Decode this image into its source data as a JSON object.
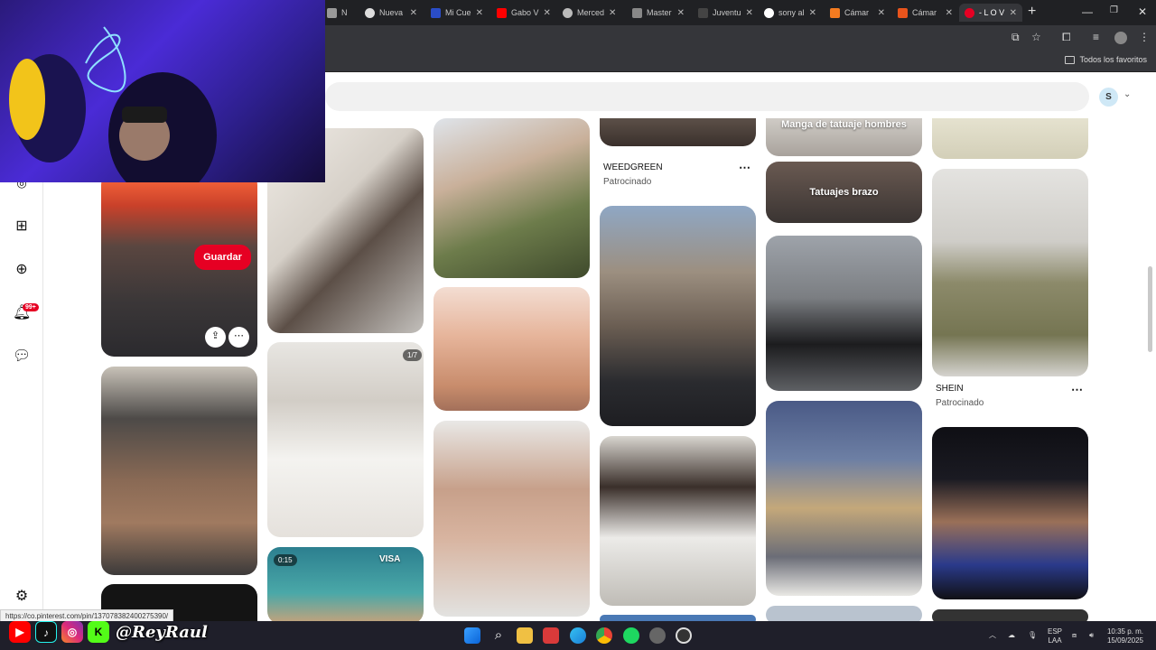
{
  "browser": {
    "tabs": [
      {
        "label": "N"
      },
      {
        "label": "Nueva"
      },
      {
        "label": "Mi Cue"
      },
      {
        "label": "Gabo V"
      },
      {
        "label": "Merced"
      },
      {
        "label": "Master"
      },
      {
        "label": "Juventu"
      },
      {
        "label": "sony al"
      },
      {
        "label": "Cámar"
      },
      {
        "label": "Cámar"
      },
      {
        "label": "- L O V"
      }
    ],
    "new_tab": "+",
    "bookmarks_folder": "Todos los favoritos"
  },
  "header": {
    "avatar_initial": "S"
  },
  "sidebar": {
    "notif_count": "99+"
  },
  "pins": {
    "save_label": "Guardar",
    "col3_a_text": "Manga de tatuaje hombres",
    "col3_b_text": "Tatuajes brazo",
    "badge_1_7": "1/7",
    "badge_time": "0:15",
    "badge_visa": "VISA",
    "ad1_title": "WEEDGREEN",
    "ad1_sub": "Patrocinado",
    "ad2_title": "SHEIN",
    "ad2_sub": "Patrocinado"
  },
  "status_url": "https://co.pinterest.com/pin/137078382400275390/",
  "overlay": {
    "handle": "@ReyRaul"
  },
  "taskbar": {
    "lang_top": "ESP",
    "lang_bottom": "LAA",
    "time": "10:35 p. m.",
    "date": "15/09/2025"
  },
  "colors": {
    "pinterest_red": "#e60023",
    "chrome_dark": "#202124"
  }
}
